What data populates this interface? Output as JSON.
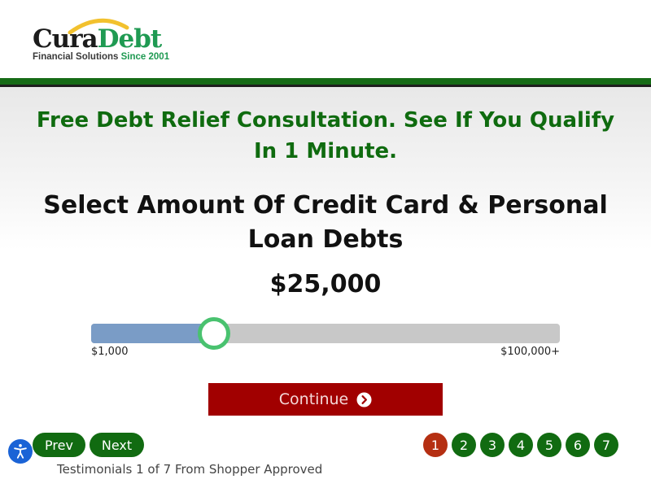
{
  "brand": {
    "name_part1": "Cura",
    "name_part2": "Debt",
    "tagline": "Financial Solutions",
    "since": "Since 2001",
    "colors": {
      "dark_green": "#166b16",
      "brand_green": "#1f9a52",
      "arc_yellow": "#f2c12e",
      "headline_green": "#0f6b0f"
    }
  },
  "hero": {
    "headline": "Free Debt Relief Consultation. See If You Qualify In 1 Minute.",
    "question": "Select Amount Of Credit Card & Personal Loan Debts"
  },
  "slider": {
    "value_label": "$25,000",
    "min_label": "$1,000",
    "max_label": "$100,000+",
    "fraction": 0.262,
    "fill_color": "#7a9cc6",
    "thumb_color": "#49c26f"
  },
  "cta": {
    "continue_label": "Continue",
    "color": "#a10000",
    "icon": "arrow-circle-right-icon"
  },
  "testimonials": {
    "prev_label": "Prev",
    "next_label": "Next",
    "pages": [
      "1",
      "2",
      "3",
      "4",
      "5",
      "6",
      "7"
    ],
    "active_page": 1,
    "caption": "Testimonials 1 of 7 From Shopper Approved"
  },
  "accessibility": {
    "icon": "accessibility-icon",
    "color": "#1a63d6"
  }
}
